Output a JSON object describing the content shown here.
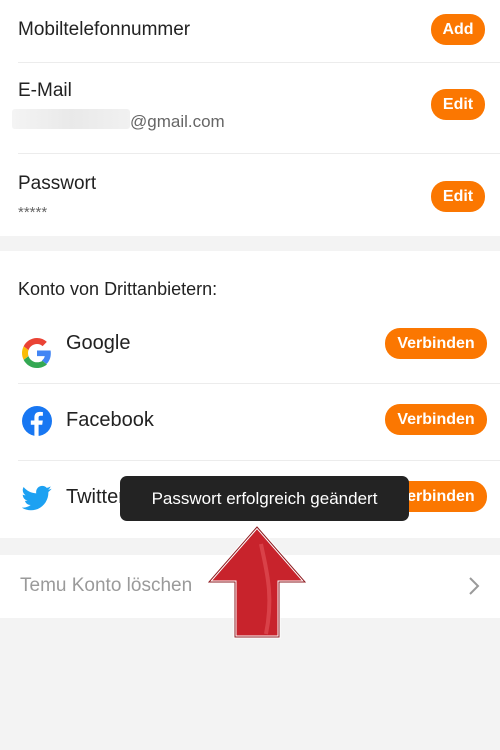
{
  "account": {
    "phone_label": "Mobiltelefonnummer",
    "phone_action": "Add",
    "email_label": "E-Mail",
    "email_value": "@gmail.com",
    "email_action": "Edit",
    "password_label": "Passwort",
    "password_value": "*****",
    "password_action": "Edit"
  },
  "third_party": {
    "title": "Konto von Drittanbietern:",
    "providers": [
      {
        "name": "Google",
        "action": "Verbinden",
        "icon": "google-icon"
      },
      {
        "name": "Facebook",
        "action": "Verbinden",
        "icon": "facebook-icon"
      },
      {
        "name": "Twitter",
        "action": "Verbinden",
        "icon": "twitter-icon"
      }
    ]
  },
  "toast": {
    "message": "Passwort erfolgreich geändert"
  },
  "delete": {
    "label": "Temu Konto löschen",
    "icon": "chevron-right-icon"
  },
  "colors": {
    "accent": "#fb7701",
    "toast_bg": "#232323"
  }
}
